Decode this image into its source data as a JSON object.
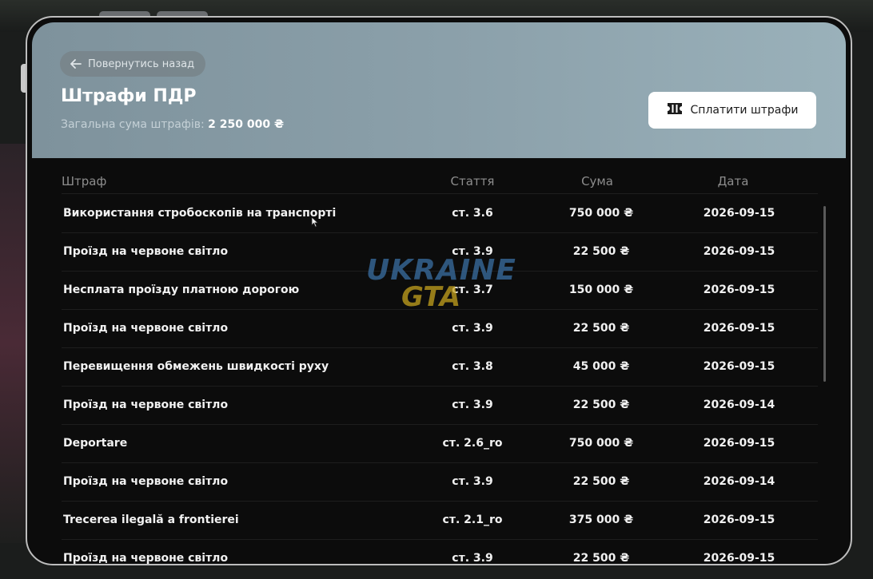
{
  "header": {
    "back_label": "Повернутись назад",
    "title": "Штрафи ПДР",
    "total_label": "Загальна сума штрафів:",
    "total_amount": "2 250 000 ₴",
    "pay_label": "Сплатити штрафи"
  },
  "table": {
    "columns": {
      "fine": "Штраф",
      "article": "Стаття",
      "amount": "Сума",
      "date": "Дата"
    },
    "rows": [
      {
        "fine": "Використання стробоскопів на транспорті",
        "article": "ст. 3.6",
        "amount": "750 000 ₴",
        "date": "2026-09-15"
      },
      {
        "fine": "Проїзд на червоне світло",
        "article": "ст. 3.9",
        "amount": "22 500 ₴",
        "date": "2026-09-15"
      },
      {
        "fine": "Несплата проїзду платною дорогою",
        "article": "ст. 3.7",
        "amount": "150 000 ₴",
        "date": "2026-09-15"
      },
      {
        "fine": "Проїзд на червоне світло",
        "article": "ст. 3.9",
        "amount": "22 500 ₴",
        "date": "2026-09-15"
      },
      {
        "fine": "Перевищення обмежень швидкості руху",
        "article": "ст. 3.8",
        "amount": "45 000 ₴",
        "date": "2026-09-15"
      },
      {
        "fine": "Проїзд на червоне світло",
        "article": "ст. 3.9",
        "amount": "22 500 ₴",
        "date": "2026-09-14"
      },
      {
        "fine": "Deportare",
        "article": "ст. 2.6_ro",
        "amount": "750 000 ₴",
        "date": "2026-09-15"
      },
      {
        "fine": "Проїзд на червоне світло",
        "article": "ст. 3.9",
        "amount": "22 500 ₴",
        "date": "2026-09-14"
      },
      {
        "fine": "Trecerea ilegală a frontierei",
        "article": "ст. 2.1_ro",
        "amount": "375 000 ₴",
        "date": "2026-09-15"
      },
      {
        "fine": "Проїзд на червоне світло",
        "article": "ст. 3.9",
        "amount": "22 500 ₴",
        "date": "2026-09-15"
      }
    ]
  },
  "watermark": {
    "line1": "UKRAINE",
    "line2": "GTA"
  },
  "icons": {
    "back": "arrow-left-icon",
    "pay": "ticket-icon"
  },
  "colors": {
    "header_bg": "#8ca1ab",
    "panel_bg": "#0c0c0c",
    "accent_white": "#ffffff"
  }
}
